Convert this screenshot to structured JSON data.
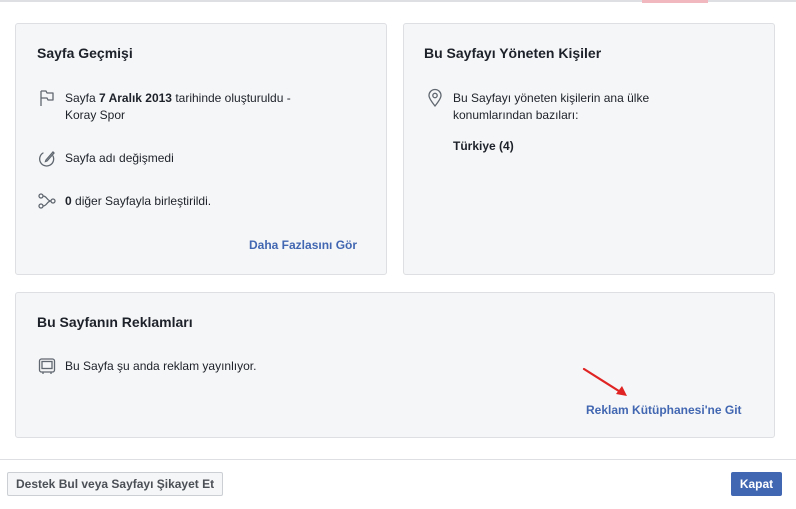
{
  "history": {
    "title": "Sayfa Geçmişi",
    "created_prefix": "Sayfa ",
    "created_date": "7 Aralık 2013",
    "created_suffix": " tarihinde oluşturuldu -",
    "created_line2": "Koray Spor",
    "name_unchanged": "Sayfa adı değişmedi",
    "merged_count": "0",
    "merged_suffix": " diğer Sayfayla birleştirildi.",
    "more_link": "Daha Fazlasını Gör"
  },
  "managers": {
    "title": "Bu Sayfayı Yöneten Kişiler",
    "location_line1": "Bu Sayfayı yöneten kişilerin ana ülke",
    "location_line2": "konumlarından bazıları:",
    "country": "Türkiye (4)"
  },
  "ads": {
    "title": "Bu Sayfanın Reklamları",
    "status": "Bu Sayfa şu anda reklam yayınlıyor.",
    "library_link": "Reklam Kütüphanesi'ne Git"
  },
  "footer": {
    "report_button": "Destek Bul veya Sayfayı Şikayet Et",
    "close_button": "Kapat"
  },
  "icons": {
    "flag": "flag-icon",
    "edit": "edit-icon",
    "merge": "merge-icon",
    "location": "location-pin-icon",
    "ad": "ad-monitor-icon"
  },
  "colors": {
    "link": "#4267b2",
    "primary_button": "#4267b2",
    "annotation_arrow": "#e02424"
  }
}
